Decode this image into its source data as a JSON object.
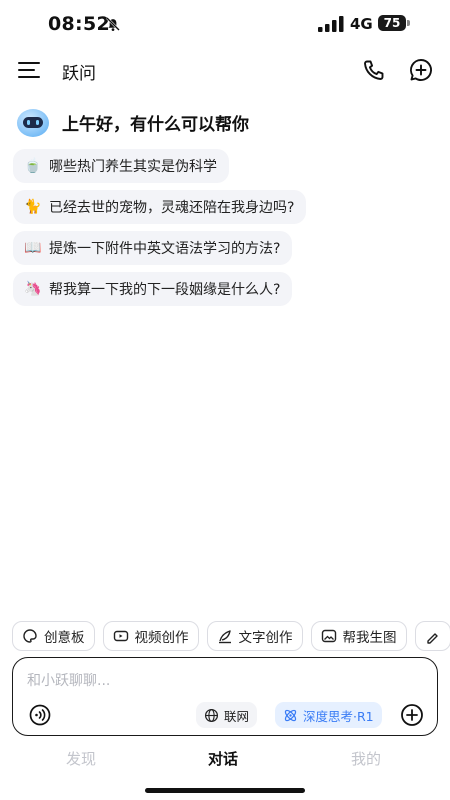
{
  "status_bar": {
    "time": "08:52",
    "network": "4G",
    "battery": "75"
  },
  "header": {
    "title": "跃问"
  },
  "greeting": "上午好，有什么可以帮你",
  "suggestions": [
    {
      "emoji": "🍵",
      "text": "哪些热门养生其实是伪科学"
    },
    {
      "emoji": "🐈",
      "text": "已经去世的宠物，灵魂还陪在我身边吗?"
    },
    {
      "emoji": "📖",
      "text": "提炼一下附件中英文语法学习的方法?"
    },
    {
      "emoji": "🦄",
      "text": "帮我算一下我的下一段姻缘是什么人?"
    }
  ],
  "chips": [
    {
      "label": "创意板",
      "icon": "creative-board-icon"
    },
    {
      "label": "视频创作",
      "icon": "video-icon"
    },
    {
      "label": "文字创作",
      "icon": "pen-icon"
    },
    {
      "label": "帮我生图",
      "icon": "image-icon"
    }
  ],
  "input": {
    "placeholder": "和小跃聊聊...",
    "web_label": "联网",
    "deep_label": "深度思考·R1"
  },
  "tabs": [
    {
      "label": "发现",
      "active": false
    },
    {
      "label": "对话",
      "active": true
    },
    {
      "label": "我的",
      "active": false
    }
  ],
  "colors": {
    "accent": "#3a7cf5",
    "accent_bg": "#e6f0ff",
    "suggestion_bg": "#f3f4f8"
  }
}
